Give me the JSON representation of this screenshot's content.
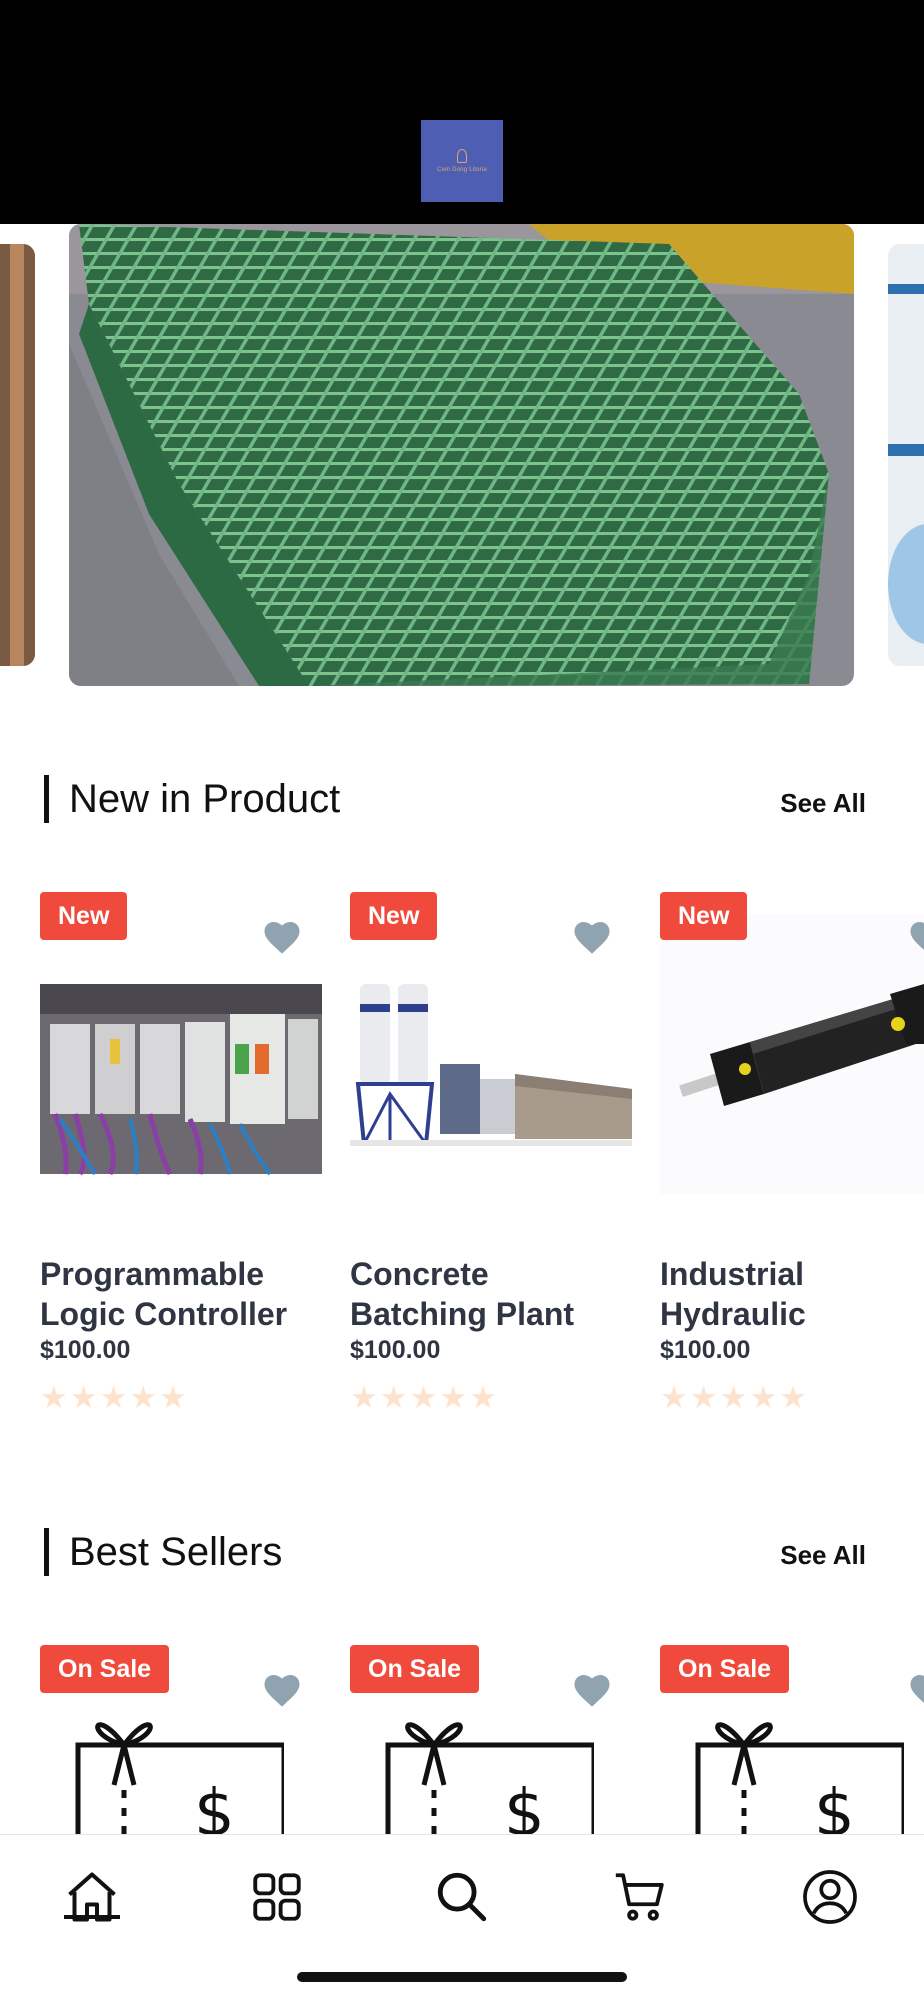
{
  "header": {
    "logo_text": "Cem Dong Litoria"
  },
  "new_products": {
    "title": "New in Product",
    "see_all": "See All",
    "items": [
      {
        "badge": "New",
        "title": "Programmable Logic Controller",
        "price": "$100.00",
        "rating": 0
      },
      {
        "badge": "New",
        "title": "Concrete Batching Plant",
        "price": "$100.00",
        "rating": 0
      },
      {
        "badge": "New",
        "title": "Industrial Hydraulic",
        "price": "$100.00",
        "rating": 0
      }
    ]
  },
  "best_sellers": {
    "title": "Best Sellers",
    "see_all": "See All",
    "items": [
      {
        "badge": "On Sale"
      },
      {
        "badge": "On Sale"
      },
      {
        "badge": "On Sale"
      }
    ]
  },
  "stars_text": "★★★★★",
  "nav": {
    "items": [
      "home-icon",
      "categories-icon",
      "search-icon",
      "cart-icon",
      "profile-icon"
    ],
    "active": "home-icon"
  },
  "colors": {
    "accent": "#ef4a3c",
    "heart": "#8fa3b0",
    "star_empty": "#fde3cd"
  }
}
